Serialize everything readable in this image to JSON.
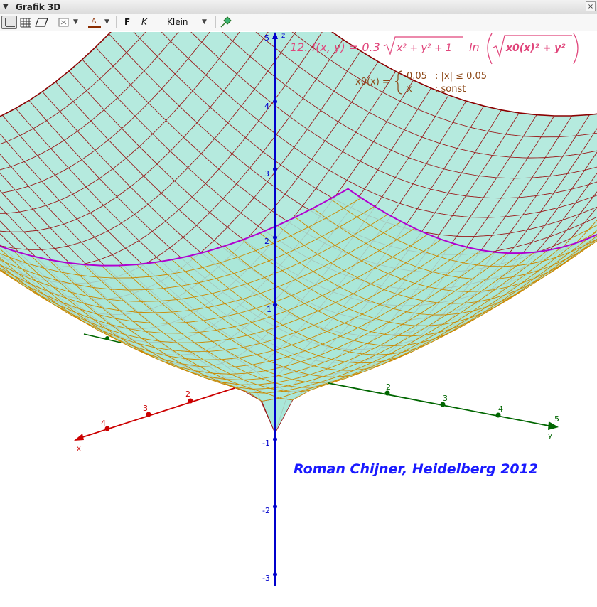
{
  "window": {
    "title": "Grafik 3D",
    "close_symbol": "×"
  },
  "toolbar": {
    "bold_label": "F",
    "italic_label": "K",
    "text_size": "Klein",
    "text_color": "#8b2d00",
    "icons": [
      "axes-icon",
      "grid-icon",
      "plane-icon",
      "point-style-icon",
      "text-color-icon",
      "pin-icon"
    ]
  },
  "plot": {
    "function_label": "12. f(x, y) = 0.3",
    "sqrt_inner": "x² + y² + 1",
    "ln_label": "ln",
    "ln_inner": "x0(x)² + y²",
    "function_color": "#e0457b",
    "piecewise_name": "x0(x) =",
    "piecewise_case1_value": "0.05",
    "piecewise_case1_cond": ": |x| ≤ 0.05",
    "piecewise_case2_value": "x",
    "piecewise_case2_cond": ": sonst",
    "piecewise_color": "#8b4513",
    "signature": "Roman Chijner, Heidelberg 2012",
    "signature_color": "#1a1aff",
    "axes": {
      "z_label": "z",
      "x_label": "x",
      "y_label": "y",
      "z_ticks": [
        "5",
        "4",
        "3",
        "2",
        "1",
        "-1",
        "-2",
        "-3"
      ],
      "x_ticks": [
        "2",
        "3",
        "4"
      ],
      "y_ticks": [
        "2",
        "3",
        "4",
        "5"
      ],
      "z_color": "#0000cc",
      "x_color": "#cc0000",
      "y_color": "#006600"
    },
    "surface_colors": {
      "fill": "#a8e6d8",
      "edge": "#8b0000",
      "grid_front": "#cc8800",
      "grid_back": "#9b1c1c",
      "boundary": "#b000d0"
    }
  }
}
